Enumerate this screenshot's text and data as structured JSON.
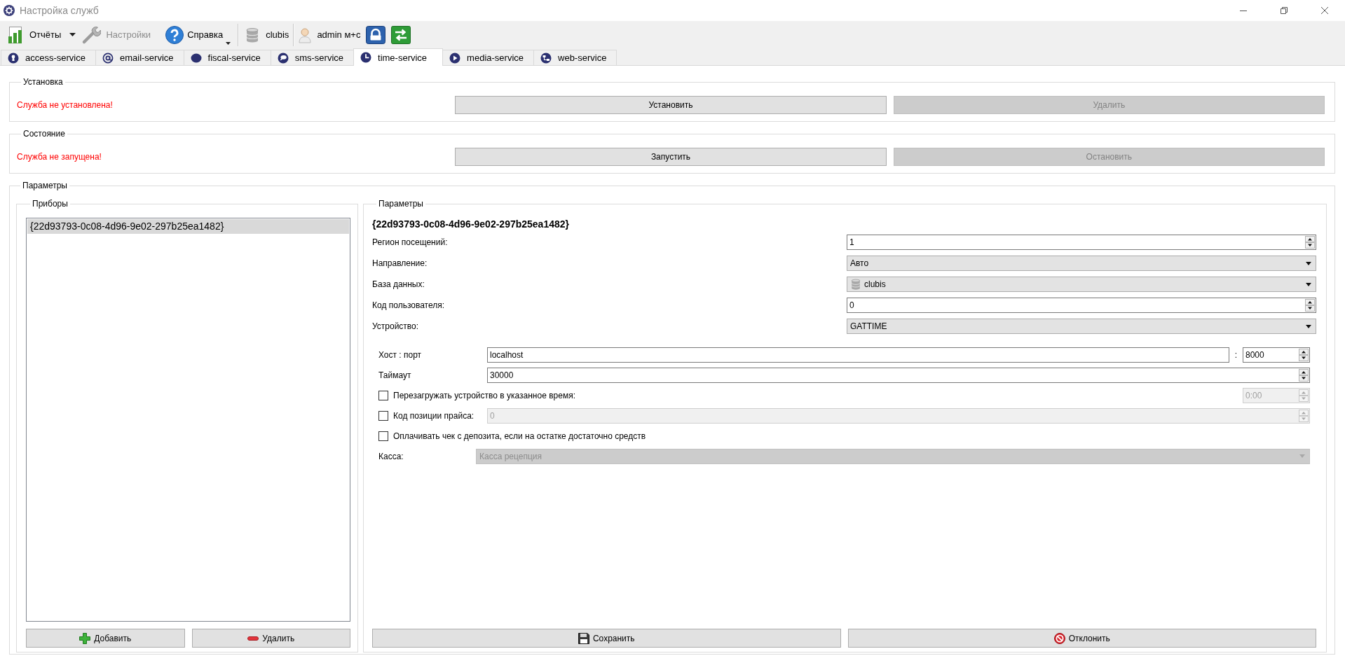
{
  "window": {
    "title": "Настройка служб"
  },
  "toolbar": {
    "reports": {
      "label": "Отчёты",
      "disabled": false
    },
    "settings": {
      "label": "Настройки",
      "disabled": true
    },
    "help": {
      "label": "Справка",
      "disabled": false
    },
    "database": {
      "label": "clubis"
    },
    "user": {
      "label": "admin м+с"
    }
  },
  "tabs": [
    {
      "label": "access-service",
      "selected": false
    },
    {
      "label": "email-service",
      "selected": false
    },
    {
      "label": "fiscal-service",
      "selected": false
    },
    {
      "label": "sms-service",
      "selected": false
    },
    {
      "label": "time-service",
      "selected": true
    },
    {
      "label": "media-service",
      "selected": false
    },
    {
      "label": "web-service",
      "selected": false
    }
  ],
  "installation": {
    "title": "Установка",
    "status": "Служба не установлена!",
    "buttons": [
      {
        "label": "Установить",
        "disabled": false
      },
      {
        "label": "Удалить",
        "disabled": true
      }
    ]
  },
  "state": {
    "title": "Состояние",
    "status": "Служба не запущена!",
    "buttons": [
      {
        "label": "Запустить",
        "disabled": false
      },
      {
        "label": "Остановить",
        "disabled": true
      }
    ]
  },
  "parameters": {
    "title": "Параметры",
    "devices": {
      "title": "Приборы",
      "items": [
        {
          "label": "{22d93793-0c08-4d96-9e02-297b25ea1482}",
          "selected": true
        }
      ],
      "buttons": [
        {
          "label": "Добавить"
        },
        {
          "label": "Удалить"
        }
      ]
    },
    "settings": {
      "title": "Параметры",
      "device_id": "{22d93793-0c08-4d96-9e02-297b25ea1482}",
      "fields": [
        {
          "kind": "spin",
          "label": "Регион посещений:",
          "value": "1"
        },
        {
          "kind": "combo",
          "label": "Направление:",
          "value": "Авто"
        },
        {
          "kind": "dbcombo",
          "label": "База данных:",
          "value": "clubis"
        },
        {
          "kind": "spin",
          "label": "Код пользователя:",
          "value": "0"
        },
        {
          "kind": "combo",
          "label": "Устройство:",
          "value": "GATTIME"
        }
      ],
      "device": {
        "host": {
          "label": "Хост : порт",
          "value": "localhost",
          "separator": ":",
          "port": "8000"
        },
        "timeout": {
          "label": "Таймаут",
          "value": "30000"
        },
        "options": [
          {
            "kind": "time",
            "label": "Перезагружать устройство в указанное время:",
            "checked": false,
            "value": "0:00",
            "disabled": true
          },
          {
            "kind": "number",
            "label": "Код позиции прайса:",
            "checked": false,
            "value": "0",
            "disabled": true
          },
          {
            "kind": "plain",
            "label": "Оплачивать чек с депозита, если на остатке достаточно средств",
            "checked": false
          }
        ],
        "cashbox": {
          "label": "Касса:",
          "value": "Касса рецепция",
          "disabled": true
        }
      },
      "buttons": [
        {
          "label": "Сохранить"
        },
        {
          "label": "Отклонить"
        }
      ]
    }
  }
}
